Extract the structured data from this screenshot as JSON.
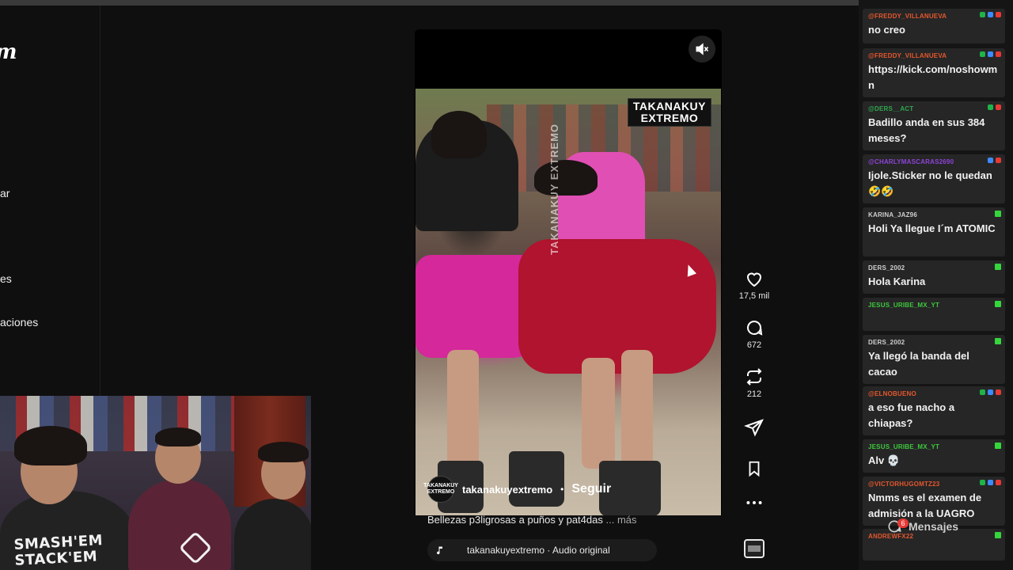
{
  "left_nav": {
    "logo_fragment": "m",
    "items": [
      "ar",
      "es",
      "aciones"
    ]
  },
  "reel": {
    "brand_tag_line1": "TAKANAKUY",
    "brand_tag_line2": "EXTREMO",
    "vertical_watermark": "TAKANAKUY EXTREMO",
    "mute_icon": "speaker-muted-icon",
    "author_avatar_text": "TAKANAKUY EXTREMO",
    "author": "takanakuyextremo",
    "separator": "•",
    "follow_label": "Seguir",
    "caption": "Bellezas p3ligrosas a puños y pat4das",
    "caption_more": "... más",
    "audio_label": "takanakuyextremo · Audio original"
  },
  "actions": {
    "like_count": "17,5 mil",
    "comment_count": "672",
    "repost_count": "212"
  },
  "webcam": {
    "shirt_text_line1": "SMASH'EM",
    "shirt_text_line2": "STACK'EM"
  },
  "chat": {
    "messages": [
      {
        "user": "@FREDDY_VILLANUEVA",
        "color": "#e4572e",
        "text": "no creo",
        "badges": [
          "g",
          "b",
          "r"
        ]
      },
      {
        "user": "@FREDDY_VILLANUEVA",
        "color": "#e4572e",
        "text": "https://kick.com/noshowmn",
        "badges": [
          "g",
          "b",
          "r"
        ]
      },
      {
        "user": "@DERS__ACT",
        "color": "#2fa84f",
        "text": "Badillo anda en sus 384 meses?",
        "badges": [
          "g",
          "r"
        ]
      },
      {
        "user": "@CHARLYMASCARAS2690",
        "color": "#8e44d9",
        "text": "Ijole.Sticker no le quedan 🤣🤣",
        "badges": [
          "b",
          "r"
        ]
      },
      {
        "user": "KARINA_JAZ96",
        "color": "#cfcfcf",
        "text": "Holi Ya llegue I´m ATOMIC",
        "badges": [
          "k"
        ]
      },
      {
        "user": "DERS_2002",
        "color": "#cfcfcf",
        "text": "Hola Karina",
        "badges": [
          "k"
        ]
      },
      {
        "user": "JESUS_URIBE_MX_YT",
        "color": "#3ec93e",
        "text": "",
        "badges": [
          "k"
        ]
      },
      {
        "user": "DERS_2002",
        "color": "#cfcfcf",
        "text": "Ya llegó la banda del cacao",
        "badges": [
          "k"
        ]
      },
      {
        "user": "@ELNOBUENO",
        "color": "#e4572e",
        "text": "a eso fue nacho a chiapas?",
        "badges": [
          "g",
          "b",
          "r"
        ]
      },
      {
        "user": "JESUS_URIBE_MX_YT",
        "color": "#3ec93e",
        "text": "Alv 💀",
        "badges": [
          "k"
        ]
      },
      {
        "user": "@VICTORHUGOMTZ23",
        "color": "#e4572e",
        "text": "Nmms es el examen de admisión a la UAGRO",
        "badges": [
          "g",
          "b",
          "r"
        ]
      },
      {
        "user": "ANDREWFX22",
        "color": "#e4572e",
        "text": "",
        "badges": [
          "k"
        ]
      }
    ],
    "mensajes_label": "Mensajes",
    "notif_count": "6"
  },
  "colors": {
    "bg": "#0f0f0f",
    "chat_bg": "#151515",
    "chat_msg_bg": "#262626",
    "kick_green": "#35d63c"
  }
}
